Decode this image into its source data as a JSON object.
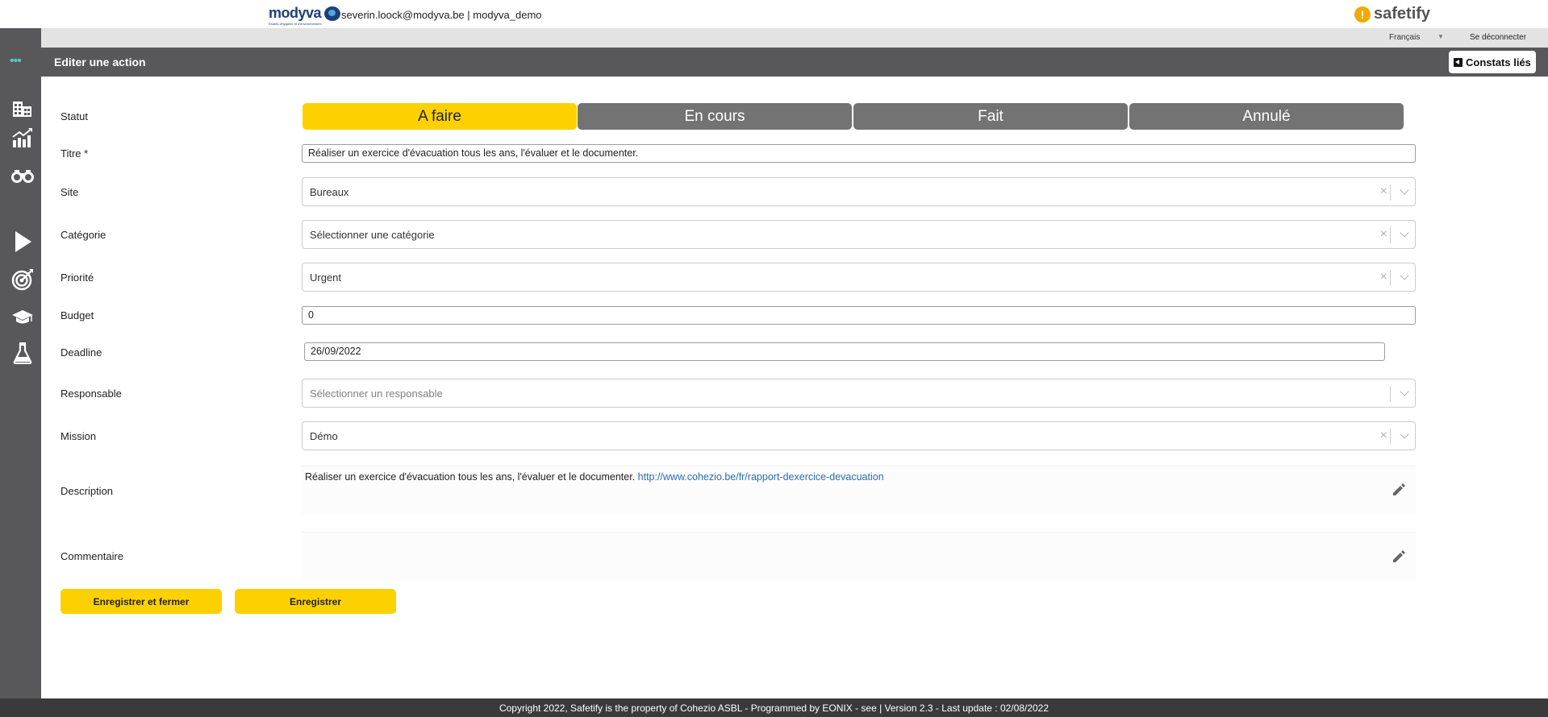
{
  "top": {
    "brand": "modyva",
    "brand_tagline": "Études d'hygiène et d'environnement",
    "user_info": "severin.loock@modyva.be | modyva_demo",
    "product": "safetify",
    "product_icon": "!",
    "language": "Français",
    "language_arrow": "▼",
    "logout": "Se déconnecter"
  },
  "sidebar": {
    "dots": "•••",
    "items": [
      {
        "icon": "building-icon"
      },
      {
        "icon": "chart-growth-icon"
      },
      {
        "icon": "binoculars-icon"
      },
      {
        "icon": "play-icon"
      },
      {
        "icon": "target-icon"
      },
      {
        "icon": "graduation-cap-icon"
      },
      {
        "icon": "flask-icon"
      }
    ]
  },
  "header": {
    "title": "Editer une action",
    "constats_label": "Constats liés"
  },
  "form": {
    "statut": {
      "label": "Statut",
      "options": [
        "A faire",
        "En cours",
        "Fait",
        "Annulé"
      ],
      "selected": "A faire"
    },
    "titre": {
      "label": "Titre *",
      "value": "Réaliser un exercice d'évacuation tous les ans, l'évaluer et le documenter."
    },
    "site": {
      "label": "Site",
      "value": "Bureaux",
      "clear": "×"
    },
    "categorie": {
      "label": "Catégorie",
      "placeholder": "Sélectionner une catégorie",
      "clear": "×"
    },
    "priorite": {
      "label": "Priorité",
      "value": "Urgent",
      "clear": "×"
    },
    "budget": {
      "label": "Budget",
      "value": "0"
    },
    "deadline": {
      "label": "Deadline",
      "value": "26/09/2022"
    },
    "responsable": {
      "label": "Responsable",
      "placeholder": "Sélectionner un responsable"
    },
    "mission": {
      "label": "Mission",
      "value": "Démo",
      "clear": "×"
    },
    "description": {
      "label": "Description",
      "text": "Réaliser un exercice d'évacuation tous les ans, l'évaluer et le documenter. ",
      "link": "http://www.cohezio.be/fr/rapport-dexercice-devacuation"
    },
    "commentaire": {
      "label": "Commentaire",
      "text": ""
    }
  },
  "actions": {
    "save_close": "Enregistrer et fermer",
    "save": "Enregistrer"
  },
  "footer": {
    "text": "Copyright 2022, Safetify is the property of Cohezio ASBL - Programmed by EONIX - see | Version 2.3 - Last update : 02/08/2022"
  },
  "colors": {
    "accent_yellow": "#fdd100",
    "sidebar_gray": "#58585a",
    "status_inactive": "#737373",
    "sidebar_dots": "#5cc8c0",
    "link": "#2a6db2"
  }
}
